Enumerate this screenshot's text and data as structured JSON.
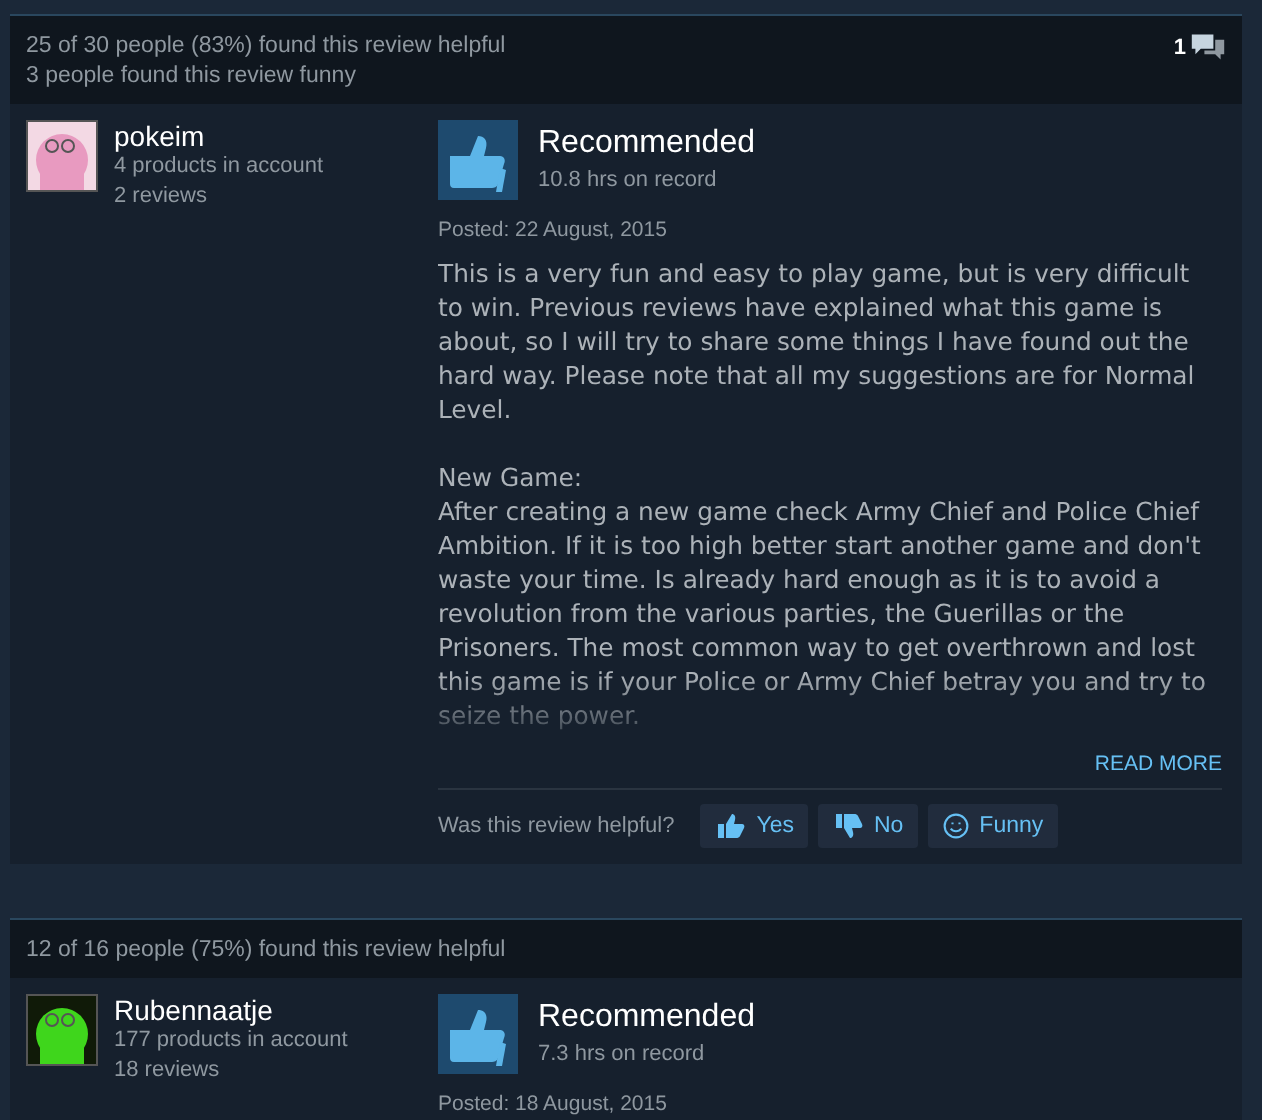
{
  "reviews": [
    {
      "helpful": "25 of 30 people (83%) found this review helpful",
      "funny": "3 people found this review funny",
      "comments": "1",
      "user": {
        "name": "pokeim",
        "products": "4 products in account",
        "reviews": "2 reviews"
      },
      "verdict": "Recommended",
      "hours": "10.8 hrs on record",
      "posted": "Posted: 22 August, 2015",
      "paragraphs": [
        "This is a very fun and easy to play game, but is very difficult to win. Previous reviews have explained what this game is about, so I will try to share some things I have found out the hard way. Please note that all my suggestions are for Normal Level.",
        "New Game:\nAfter creating a new game check Army Chief and Police Chief Ambition. If it is too high better start another game and don't waste your time. Is already hard enough as it is to avoid a revolution from the various parties, the Guerillas or the Prisoners. The most common way to get overthrown and lost this game is if your Police or Army Chief betray you and try to seize the power."
      ],
      "read_more": "READ MORE",
      "vote": {
        "prompt": "Was this review helpful?",
        "buttons": [
          {
            "kind": "up",
            "label": "Yes"
          },
          {
            "kind": "down",
            "label": "No"
          },
          {
            "kind": "funny",
            "label": "Funny"
          }
        ]
      }
    },
    {
      "helpful": "12 of 16 people (75%) found this review helpful",
      "user": {
        "name": "Rubennaatje",
        "products": "177 products in account",
        "reviews": "18 reviews"
      },
      "verdict": "Recommended",
      "hours": "7.3 hrs on record",
      "posted": "Posted: 18 August, 2015"
    }
  ]
}
